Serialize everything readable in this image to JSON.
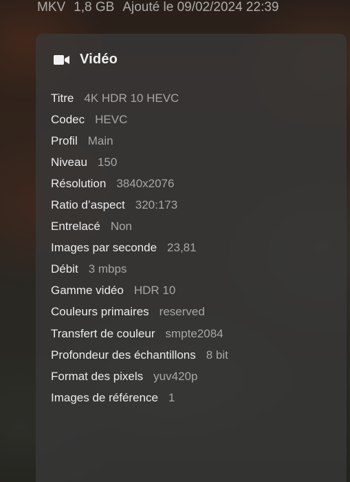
{
  "file_meta": {
    "container": "MKV",
    "size": "1,8 GB",
    "added": "Ajouté le 09/02/2024 22:39"
  },
  "video_panel": {
    "title": "Vidéo",
    "icon": "video-camera-icon",
    "rows": [
      {
        "label": "Titre",
        "value": "4K HDR 10 HEVC"
      },
      {
        "label": "Codec",
        "value": "HEVC"
      },
      {
        "label": "Profil",
        "value": "Main"
      },
      {
        "label": "Niveau",
        "value": "150"
      },
      {
        "label": "Résolution",
        "value": "3840x2076"
      },
      {
        "label": "Ratio d’aspect",
        "value": "320:173"
      },
      {
        "label": "Entrelacé",
        "value": "Non"
      },
      {
        "label": "Images par seconde",
        "value": "23,81"
      },
      {
        "label": "Débit",
        "value": "3 mbps"
      },
      {
        "label": "Gamme vidéo",
        "value": "HDR 10"
      },
      {
        "label": "Couleurs primaires",
        "value": "reserved"
      },
      {
        "label": "Transfert de couleur",
        "value": "smpte2084"
      },
      {
        "label": "Profondeur des échantillons",
        "value": "8 bit"
      },
      {
        "label": "Format des pixels",
        "value": "yuv420p"
      },
      {
        "label": "Images de référence",
        "value": "1"
      }
    ]
  }
}
